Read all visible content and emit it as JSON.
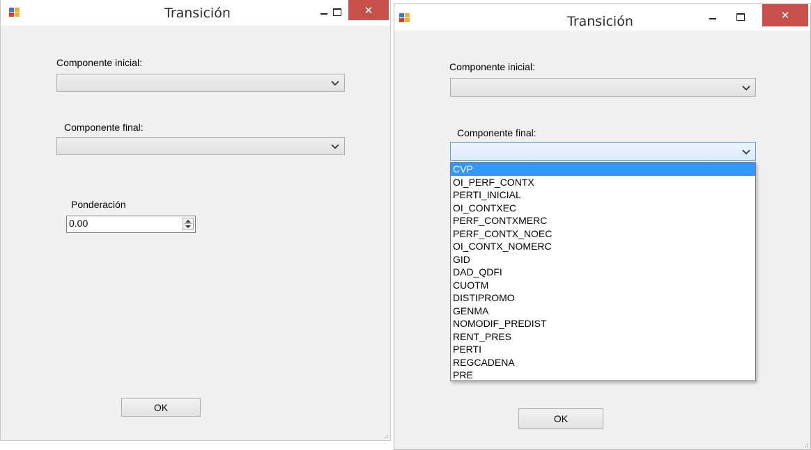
{
  "dialog_title": "Transición",
  "caption_buttons": {
    "minimize": "—",
    "maximize": "☐",
    "close": "✕"
  },
  "left_window": {
    "initial_component_label": "Componente inicial:",
    "final_component_label": "Componente final:",
    "weighting_label": "Ponderación",
    "weighting_value": "0.00",
    "ok_label": "OK"
  },
  "right_window": {
    "initial_component_label": "Componente inicial:",
    "final_component_label": "Componente final:",
    "ok_label": "OK",
    "dropdown_items": [
      "CVP",
      "OI_PERF_CONTX",
      "PERTI_INICIAL",
      "OI_CONTXEC",
      "PERF_CONTXMERC",
      "PERF_CONTX_NOEC",
      "OI_CONTX_NOMERC",
      "GID",
      "DAD_QDFI",
      "CUOTM",
      "DISTIPROMO",
      "GENMA",
      "NOMODIF_PREDIST",
      "RENT_PRES",
      "PERTI",
      "REGCADENA",
      "PRE"
    ],
    "selected_item": "CVP"
  },
  "colors": {
    "close_red": "#c7504a",
    "selection_blue": "#3399ff",
    "window_bg": "#f0f0f0"
  },
  "icons": [
    "app-icon",
    "minimize-icon",
    "maximize-icon",
    "close-icon",
    "chevron-down-icon",
    "spin-up-icon",
    "spin-down-icon",
    "resize-grip-icon"
  ]
}
